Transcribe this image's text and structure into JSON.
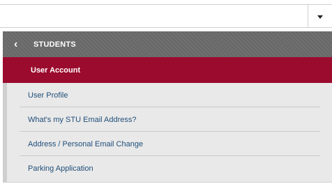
{
  "top_select": {
    "value": ""
  },
  "menu": {
    "header_label": "STUDENTS",
    "section_title": "User Account",
    "items": [
      {
        "label": "User Profile"
      },
      {
        "label": "What's my STU Email Address?"
      },
      {
        "label": "Address / Personal Email Change"
      },
      {
        "label": "Parking Application"
      }
    ]
  },
  "colors": {
    "header_bg": "#6b6b6b",
    "section_bg": "#9b0b2d",
    "list_bg": "#e9e9e9",
    "link_text": "#1f4e79"
  },
  "icons": {
    "back": "chevron-left-icon",
    "dropdown": "caret-down-icon"
  }
}
